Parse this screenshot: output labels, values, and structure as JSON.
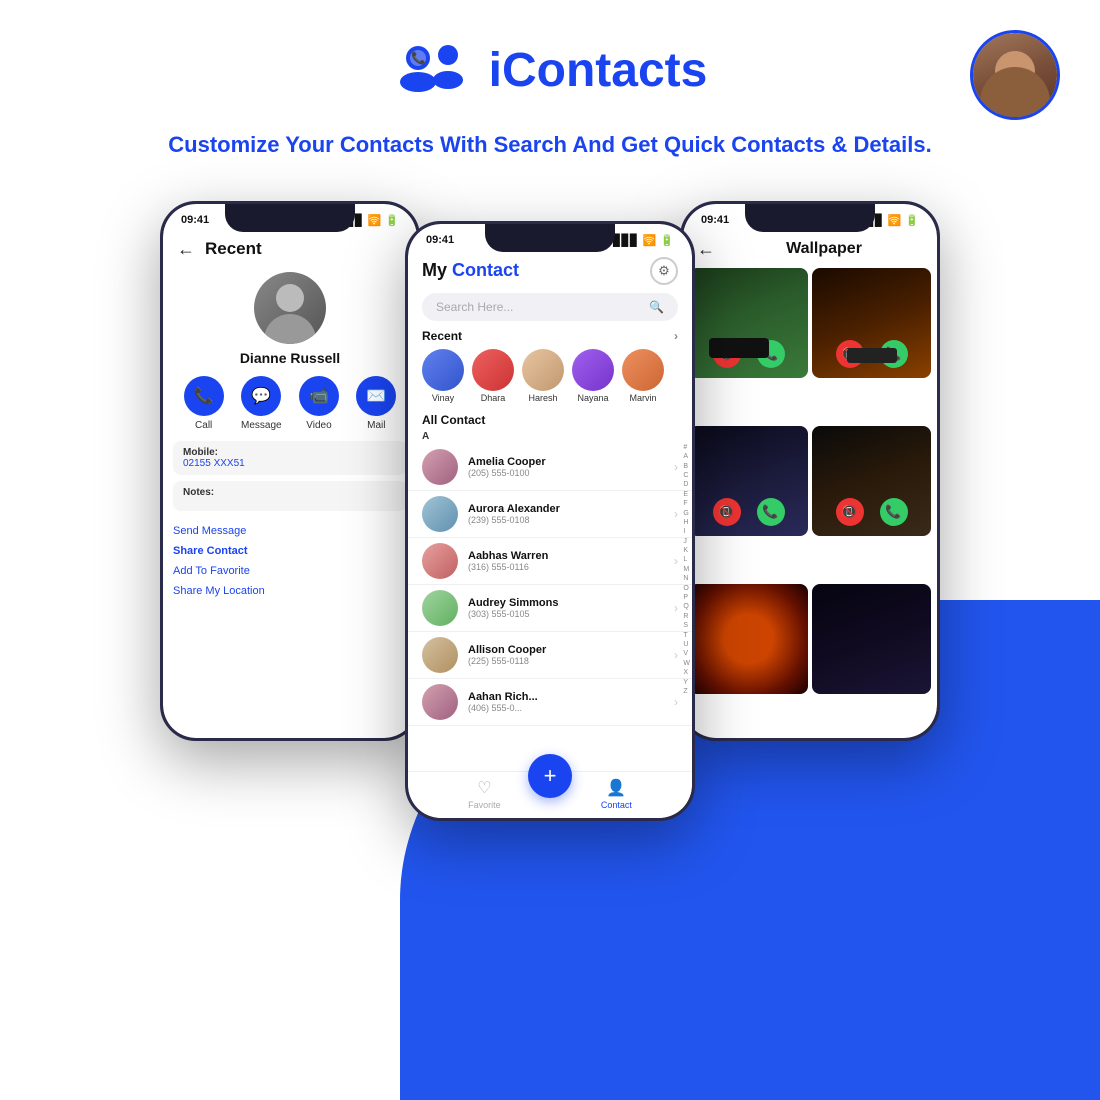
{
  "app": {
    "title": "iContacts",
    "tagline": "Customize Your Contacts With Search And Get Quick Contacts & Details."
  },
  "header": {
    "time": "09:41"
  },
  "phone1": {
    "title": "Recent",
    "contact_name": "Dianne Russell",
    "actions": [
      "Call",
      "Message",
      "Video",
      "Mail"
    ],
    "mobile_label": "Mobile:",
    "mobile_value": "02155 XXX51",
    "notes_label": "Notes:",
    "menu_items": [
      "Send Message",
      "Share Contact",
      "Add To Favorite",
      "Share My Location"
    ]
  },
  "phone2": {
    "title_part1": "My ",
    "title_part2": "Contact",
    "search_placeholder": "Search Here...",
    "recent_label": "Recent",
    "all_contact_label": "All Contact",
    "alpha_label": "A",
    "recent_contacts": [
      {
        "name": "Vinay"
      },
      {
        "name": "Dhara"
      },
      {
        "name": "Haresh"
      },
      {
        "name": "Nayana"
      },
      {
        "name": "Marvin"
      }
    ],
    "contacts": [
      {
        "name": "Amelia Cooper",
        "phone": "(205) 555-0100"
      },
      {
        "name": "Aurora Alexander",
        "phone": "(239) 555-0108"
      },
      {
        "name": "Aabhas Warren",
        "phone": "(316) 555-0116"
      },
      {
        "name": "Audrey Simmons",
        "phone": "(303) 555-0105"
      },
      {
        "name": "Allison Cooper",
        "phone": "(225) 555-0118"
      },
      {
        "name": "Aahan Rich...",
        "phone": "(406) 555-0..."
      }
    ],
    "alphabet": [
      "#",
      "A",
      "B",
      "C",
      "D",
      "E",
      "F",
      "G",
      "H",
      "I",
      "J",
      "K",
      "L",
      "M",
      "N",
      "O",
      "P",
      "Q",
      "R",
      "S",
      "T",
      "U",
      "V",
      "W",
      "X",
      "Y",
      "Z"
    ],
    "nav_favorite": "Favorite",
    "nav_contact": "Contact"
  },
  "phone3": {
    "title": "Wallpaper",
    "wallpapers": [
      {
        "bg": "forest"
      },
      {
        "bg": "sunset-car"
      },
      {
        "bg": "dark-street"
      },
      {
        "bg": "night-building"
      },
      {
        "bg": "red-moon"
      },
      {
        "bg": "purple-night"
      }
    ]
  },
  "colors": {
    "primary": "#1a44f0",
    "wave_bg": "#2255ee"
  }
}
